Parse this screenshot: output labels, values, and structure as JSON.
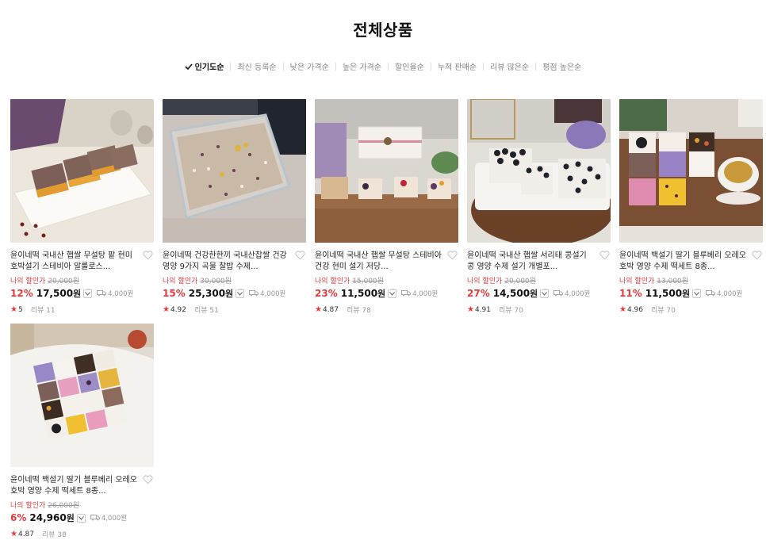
{
  "page_title": "전체상품",
  "sort_options": [
    {
      "label": "인기도순",
      "active": true
    },
    {
      "label": "최신 등록순",
      "active": false
    },
    {
      "label": "낮은 가격순",
      "active": false
    },
    {
      "label": "높은 가격순",
      "active": false
    },
    {
      "label": "할인율순",
      "active": false
    },
    {
      "label": "누적 판매순",
      "active": false
    },
    {
      "label": "리뷰 많은순",
      "active": false
    },
    {
      "label": "평점 높은순",
      "active": false
    }
  ],
  "promo_label": "나의 할인가",
  "products": [
    {
      "name": "윤이네떡 국내산 햅쌀 무설탕 팥 현미호박설기 스테비아 알룰로스...",
      "original_price": "20,000원",
      "discount": "12%",
      "price": "17,500",
      "won": "원",
      "shipping": "4,000원",
      "rating": "5",
      "reviews": "리뷰 11"
    },
    {
      "name": "윤이네떡 건강한한끼 국내산찹쌀 건강 영양 9가지 곡물 찰밥 수제...",
      "original_price": "30,000원",
      "discount": "15%",
      "price": "25,300",
      "won": "원",
      "shipping": "4,000원",
      "rating": "4.92",
      "reviews": "리뷰 51"
    },
    {
      "name": "윤이네떡 국내산 햅쌀 무설탕 스테비아 건강 현미 설기 저당...",
      "original_price": "15,000원",
      "discount": "23%",
      "price": "11,500",
      "won": "원",
      "shipping": "4,000원",
      "rating": "4.87",
      "reviews": "리뷰 78"
    },
    {
      "name": "윤이네떡 국내산 햅쌀 서리태 콩설기 콩 영양 수제 설기 개별포...",
      "original_price": "20,000원",
      "discount": "27%",
      "price": "14,500",
      "won": "원",
      "shipping": "4,000원",
      "rating": "4.91",
      "reviews": "리뷰 70"
    },
    {
      "name": "윤이네떡 백설기 딸기 블루베리 오레오 호박 영양 수제 떡세트 8종...",
      "original_price": "13,000원",
      "discount": "11%",
      "price": "11,500",
      "won": "원",
      "shipping": "4,000원",
      "rating": "4.96",
      "reviews": "리뷰 70"
    },
    {
      "name": "윤이네떡 백설기 딸기 블루베리 오레오 호박 영양 수제 떡세트 8종...",
      "original_price": "26,000원",
      "discount": "6%",
      "price": "24,960",
      "won": "원",
      "shipping": "4,000원",
      "rating": "4.87",
      "reviews": "리뷰 38"
    }
  ],
  "icons": {
    "check": "check-icon",
    "heart": "heart-outline-icon",
    "chevron": "chevron-down-icon",
    "truck": "truck-icon",
    "star": "star-icon"
  },
  "colors": {
    "accent": "#e53b3b",
    "text": "#222222",
    "muted": "#999999"
  }
}
